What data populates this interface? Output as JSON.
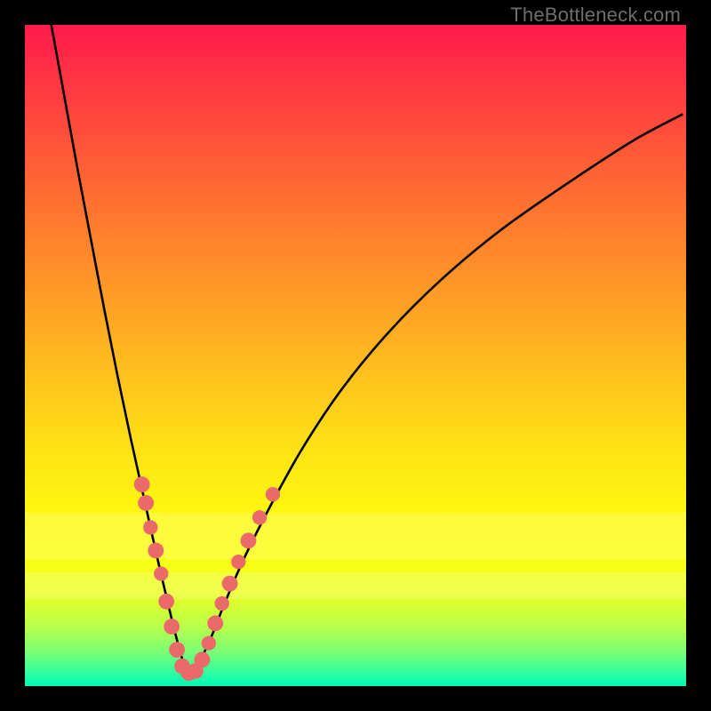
{
  "watermark": "TheBottleneck.com",
  "colors": {
    "gradient": [
      "#ff1a4d",
      "#ff3a41",
      "#ff6135",
      "#ff8a2a",
      "#ffb81f",
      "#ffe215",
      "#fdf80f",
      "#fcff12",
      "#e9ff25",
      "#b9ff4a",
      "#77ff76",
      "#2fffa2",
      "#00f7b3"
    ],
    "curve": "#000000",
    "marker": "#ea6a6a",
    "frame": "#000000"
  },
  "haze_bands": [
    {
      "top_pct": 73.8,
      "height_pct": 7.0
    },
    {
      "top_pct": 82.8,
      "height_pct": 4.0
    }
  ],
  "chart_data": {
    "type": "line",
    "title": "",
    "xlabel": "",
    "ylabel": "",
    "xlim": [
      0,
      100
    ],
    "ylim": [
      0,
      100
    ],
    "note": "Values are read in plot-percentage coordinates (0–100 on each axis). Two monotone branches meeting at a minimum around x≈24.",
    "series": [
      {
        "name": "curve",
        "x": [
          4,
          6,
          8,
          10,
          12,
          14,
          16,
          18,
          20,
          22,
          23,
          24,
          25,
          26,
          28,
          30,
          33,
          37,
          42,
          48,
          55,
          63,
          72,
          82,
          92,
          99.5
        ],
        "y": [
          100,
          89,
          78,
          67.5,
          57,
          47,
          37.5,
          28.5,
          19.5,
          11,
          7,
          3.5,
          2,
          3,
          7,
          12,
          19,
          27,
          36,
          45,
          53.5,
          61.5,
          69,
          76,
          82.5,
          86.5
        ]
      }
    ],
    "markers": {
      "name": "highlight-dots",
      "points": [
        {
          "x": 17.7,
          "y": 30.5,
          "r": 1.2
        },
        {
          "x": 18.3,
          "y": 27.7,
          "r": 1.2
        },
        {
          "x": 19.0,
          "y": 24.0,
          "r": 1.1
        },
        {
          "x": 19.8,
          "y": 20.5,
          "r": 1.2
        },
        {
          "x": 20.6,
          "y": 17.0,
          "r": 1.1
        },
        {
          "x": 21.4,
          "y": 12.8,
          "r": 1.2
        },
        {
          "x": 22.2,
          "y": 9.0,
          "r": 1.2
        },
        {
          "x": 23.0,
          "y": 5.5,
          "r": 1.2
        },
        {
          "x": 23.8,
          "y": 3.0,
          "r": 1.2
        },
        {
          "x": 24.8,
          "y": 2.0,
          "r": 1.2
        },
        {
          "x": 25.8,
          "y": 2.3,
          "r": 1.2
        },
        {
          "x": 26.8,
          "y": 4.0,
          "r": 1.2
        },
        {
          "x": 27.8,
          "y": 6.5,
          "r": 1.1
        },
        {
          "x": 28.8,
          "y": 9.5,
          "r": 1.2
        },
        {
          "x": 29.8,
          "y": 12.5,
          "r": 1.1
        },
        {
          "x": 31.0,
          "y": 15.5,
          "r": 1.2
        },
        {
          "x": 32.3,
          "y": 18.8,
          "r": 1.1
        },
        {
          "x": 33.8,
          "y": 22.0,
          "r": 1.2
        },
        {
          "x": 35.5,
          "y": 25.5,
          "r": 1.1
        },
        {
          "x": 37.5,
          "y": 29.0,
          "r": 1.1
        }
      ]
    }
  }
}
